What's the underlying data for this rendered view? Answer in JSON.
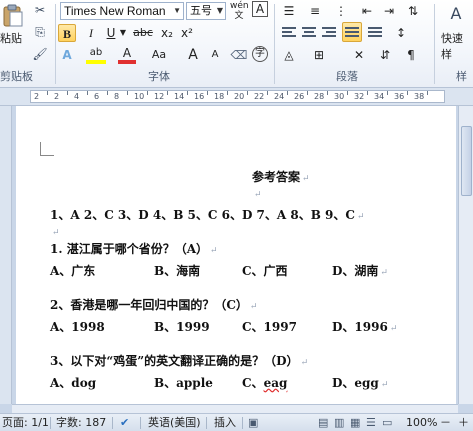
{
  "ribbon": {
    "clipboard": {
      "paste_label": "粘贴",
      "group_label": "剪贴板"
    },
    "font": {
      "font_name": "Times New Roman",
      "font_size": "五号",
      "group_label": "字体",
      "bold_label": "B",
      "italic_label": "I",
      "underline_label": "U",
      "strike_label": "abc",
      "subscript_label": "x₂",
      "superscript_label": "x²",
      "grow_label": "A",
      "shrink_label": "A",
      "wen_label": "wén",
      "char_border_label": "A",
      "circle_label": "字",
      "font_color_label": "A",
      "highlight_label": "ab",
      "effects_label": "A",
      "case_label": "Aa"
    },
    "paragraph": {
      "group_label": "段落"
    },
    "styles": {
      "quick_label": "快速样",
      "group_label": "样"
    }
  },
  "ruler": {
    "numbers": [
      "2",
      "2",
      "4",
      "6",
      "8",
      "10",
      "12",
      "14",
      "16",
      "18",
      "20",
      "22",
      "24",
      "26",
      "28",
      "30",
      "32",
      "34",
      "36",
      "38"
    ]
  },
  "document": {
    "title": "参考答案",
    "answers_line": "1、A  2、C  3、D  4、B  5、C  6、D  7、A  8、B  9、C",
    "q1": {
      "question": "1.  湛江属于哪个省份？（A）",
      "options": [
        "A、广东",
        "B、海南",
        "C、广西",
        "D、湖南"
      ]
    },
    "q2": {
      "question": "2、香港是哪一年回归中国的？（C）",
      "options": [
        "A、1998",
        "B、1999",
        "C、1997",
        "D、1996"
      ]
    },
    "q3": {
      "question": "3、以下对“鸡蛋”的英文翻译正确的是？（D）",
      "options": [
        "A、dog",
        "B、apple",
        "C、eag",
        "D、egg"
      ]
    },
    "para_mark": "↵"
  },
  "status_bar": {
    "page": "页面: 1/1",
    "words": "字数: 187",
    "language": "英语(美国)",
    "insert": "插入",
    "zoom": "100%",
    "minus": "－",
    "plus": "＋"
  }
}
